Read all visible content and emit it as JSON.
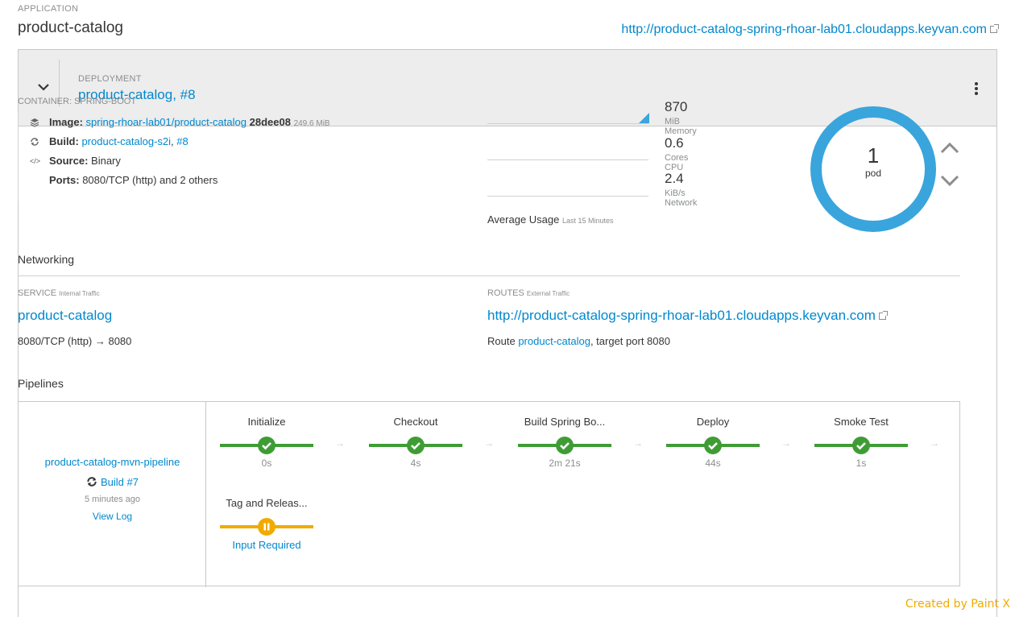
{
  "application": {
    "label": "APPLICATION",
    "name": "product-catalog",
    "url": "http://product-catalog-spring-rhoar-lab01.cloudapps.keyvan.com"
  },
  "deployment": {
    "label": "DEPLOYMENT",
    "name": "product-catalog",
    "revision": "#8",
    "separator": ", "
  },
  "container": {
    "label": "CONTAINER: SPRING-BOOT",
    "image_label": "Image:",
    "image_name": "spring-rhoar-lab01/product-catalog",
    "image_sha": "28dee08",
    "image_size": "249.6 MiB",
    "build_label": "Build:",
    "build_name": "product-catalog-s2i",
    "build_num": "#8",
    "build_sep": ",",
    "source_label": "Source:",
    "source_value": "Binary",
    "ports_label": "Ports:",
    "ports_value": "8080/TCP (http) and 2 others"
  },
  "metrics": {
    "memory_value": "870",
    "memory_unit": "MiB Memory",
    "cpu_value": "0.6",
    "cpu_unit": "Cores CPU",
    "network_value": "2.4",
    "network_unit": "KiB/s Network",
    "avg_label": "Average Usage",
    "avg_period": "Last 15 Minutes"
  },
  "pods": {
    "count": "1",
    "label": "pod",
    "ring_color": "#39a5dc"
  },
  "networking": {
    "title": "Networking",
    "service_label": "SERVICE",
    "service_sub": "Internal Traffic",
    "service_name": "product-catalog",
    "service_port": "8080/TCP (http) → 8080",
    "routes_label": "ROUTES",
    "routes_sub": "External Traffic",
    "route_url": "http://product-catalog-spring-rhoar-lab01.cloudapps.keyvan.com",
    "route_prefix": "Route",
    "route_name": "product-catalog",
    "route_suffix": ", target port 8080"
  },
  "pipelines": {
    "title": "Pipelines",
    "name": "product-catalog-mvn-pipeline",
    "build": "Build #7",
    "time": "5 minutes ago",
    "view_log": "View Log",
    "stages": [
      {
        "name": "Initialize",
        "duration": "0s",
        "status": "success"
      },
      {
        "name": "Checkout",
        "duration": "4s",
        "status": "success"
      },
      {
        "name": "Build Spring Bo...",
        "duration": "2m 21s",
        "status": "success"
      },
      {
        "name": "Deploy",
        "duration": "44s",
        "status": "success"
      },
      {
        "name": "Smoke Test",
        "duration": "1s",
        "status": "success"
      },
      {
        "name": "Tag and Releas...",
        "duration": "Input Required",
        "status": "paused"
      }
    ]
  },
  "colors": {
    "success": "#3f9c35",
    "paused": "#f0ab00",
    "link": "#0088ce"
  },
  "watermark": "Created by Paint X"
}
